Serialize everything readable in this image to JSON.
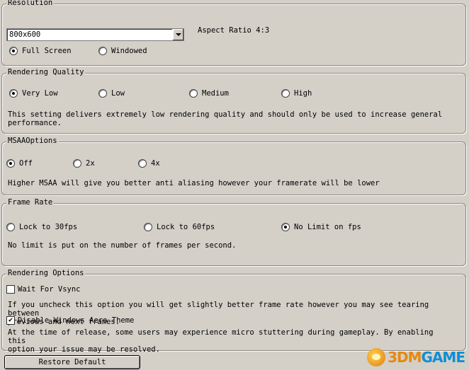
{
  "resolution": {
    "legend": "Resolution",
    "selected": "800x600",
    "aspect_label": "Aspect Ratio 4:3",
    "modes": [
      {
        "label": "Full Screen",
        "checked": true
      },
      {
        "label": "Windowed",
        "checked": false
      }
    ]
  },
  "quality": {
    "legend": "Rendering Quality",
    "options": [
      {
        "label": "Very Low",
        "checked": true
      },
      {
        "label": "Low",
        "checked": false
      },
      {
        "label": "Medium",
        "checked": false
      },
      {
        "label": "High",
        "checked": false
      }
    ],
    "description": "This setting delivers extremely low rendering quality and should only be used to increase general\nperformance."
  },
  "msaa": {
    "legend": "MSAAOptions",
    "options": [
      {
        "label": "Off",
        "checked": true
      },
      {
        "label": "2x",
        "checked": false
      },
      {
        "label": "4x",
        "checked": false
      }
    ],
    "description": "Higher MSAA will give you better anti aliasing however your framerate will be lower"
  },
  "framerate": {
    "legend": "Frame Rate",
    "options": [
      {
        "label": "Lock  to 30fps",
        "checked": false
      },
      {
        "label": "Lock to 60fps",
        "checked": false
      },
      {
        "label": "No Limit on fps",
        "checked": true
      }
    ],
    "description": "No limit is put on the number of frames per second."
  },
  "render_options": {
    "legend": "Rendering Options",
    "vsync": {
      "label": "Wait For Vsync",
      "checked": false
    },
    "vsync_desc": "If you uncheck this option you will get slightly better frame rate however you may see tearing between\nprevious and next frames.",
    "aero": {
      "label": "Disable Windows Aero Theme",
      "checked": true
    },
    "aero_desc": "At the time of release, some users may experience micro stuttering during gameplay. By enabling this\noption your issue may be resolved."
  },
  "restore_button": "Restore Default",
  "watermark": {
    "prefix": "3DM",
    "suffix": "GAME"
  }
}
